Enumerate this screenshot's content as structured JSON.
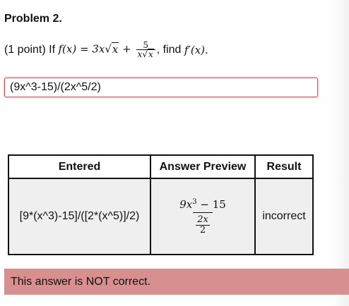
{
  "problem": {
    "title": "Problem 2.",
    "points": "(1 point) If",
    "f_of_x": "f(x)",
    "equals": "=",
    "coef": "3x",
    "radicand": "x",
    "plus": "+",
    "frac_num": "5",
    "frac_den_x": "x",
    "frac_den_radicand": "x",
    "find_text": ", find",
    "derivative": "f′(x)",
    "period": "."
  },
  "answer": {
    "value": "(9x^3-15)/(2x^5/2)"
  },
  "table": {
    "headers": [
      "Entered",
      "Answer Preview",
      "Result"
    ],
    "row": {
      "entered": "[9*(x^3)-15]/([2*(x^5)]/2)",
      "preview_num_base": "9x",
      "preview_num_exp": "3",
      "preview_num_rest": " − 15",
      "preview_den_num": "2x",
      "preview_den_den": "2",
      "result": "incorrect"
    }
  },
  "message": {
    "text": "This answer is NOT correct."
  },
  "colors": {
    "error_bg": "#d88f8f",
    "input_border": "#c95454",
    "cell_bg": "#efefef"
  }
}
